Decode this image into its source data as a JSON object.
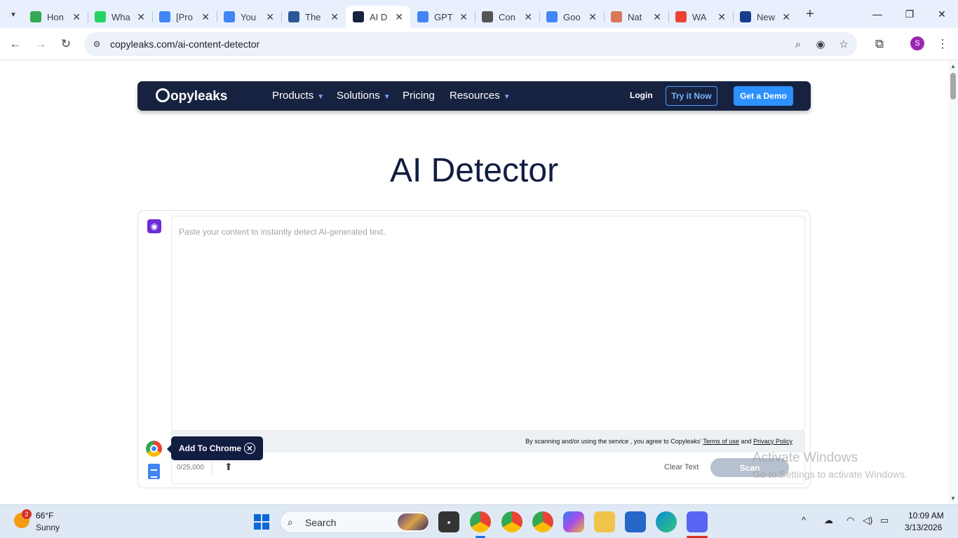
{
  "browser": {
    "tabs": [
      {
        "title": "Hon",
        "favicon": "drive-icon",
        "color": "#34a853"
      },
      {
        "title": "Wha",
        "favicon": "whatsapp-icon",
        "color": "#25d366"
      },
      {
        "title": "[Pro",
        "favicon": "docs-icon",
        "color": "#4285f4"
      },
      {
        "title": "You",
        "favicon": "docs-icon",
        "color": "#4285f4"
      },
      {
        "title": "The",
        "favicon": "word-icon",
        "color": "#2b5797"
      },
      {
        "title": "AI D",
        "favicon": "copyleaks-icon",
        "color": "#172240",
        "active": true
      },
      {
        "title": "GPT",
        "favicon": "docs-icon",
        "color": "#4285f4"
      },
      {
        "title": "Con",
        "favicon": "openai-icon",
        "color": "#555555"
      },
      {
        "title": "Goo",
        "favicon": "gemini-icon",
        "color": "#4285f4"
      },
      {
        "title": "Nat",
        "favicon": "claude-icon",
        "color": "#d97757"
      },
      {
        "title": "WA",
        "favicon": "google-icon",
        "color": "#ea4335"
      },
      {
        "title": "New",
        "favicon": "r-icon",
        "color": "#1a3e8c"
      }
    ],
    "url": "copyleaks.com/ai-content-detector",
    "profile_initial": "S"
  },
  "site": {
    "nav": {
      "logo": "opyleaks",
      "menu": [
        {
          "label": "Products",
          "dropdown": true
        },
        {
          "label": "Solutions",
          "dropdown": true
        },
        {
          "label": "Pricing",
          "dropdown": false
        },
        {
          "label": "Resources",
          "dropdown": true
        }
      ],
      "login": "Login",
      "try_now": "Try it Now",
      "get_demo": "Get a Demo"
    },
    "heading": "AI Detector",
    "editor": {
      "placeholder": "Paste your content to instantly detect AI-generated text.",
      "terms_prefix": "By scanning and/or using the service , you agree to Copyleaks'",
      "terms_link": "Terms of use",
      "terms_mid": "and",
      "privacy_link": "Privacy Policy",
      "counter": "0/25,000",
      "clear": "Clear Text",
      "scan": "Scan"
    },
    "add_to_chrome": "Add To Chrome"
  },
  "watermark": {
    "line1": "Activate Windows",
    "line2": "Go to Settings to activate Windows."
  },
  "taskbar": {
    "weather_badge": "2",
    "temperature": "66°F",
    "condition": "Sunny",
    "search_label": "Search",
    "clock_time": "10:09 AM",
    "clock_date": "3/13/2026"
  },
  "colors": {
    "brand_navy": "#172240",
    "accent_blue": "#2d91ff",
    "scan_disabled": "#b7c0cf",
    "ai_purple": "#6c2bd9"
  }
}
